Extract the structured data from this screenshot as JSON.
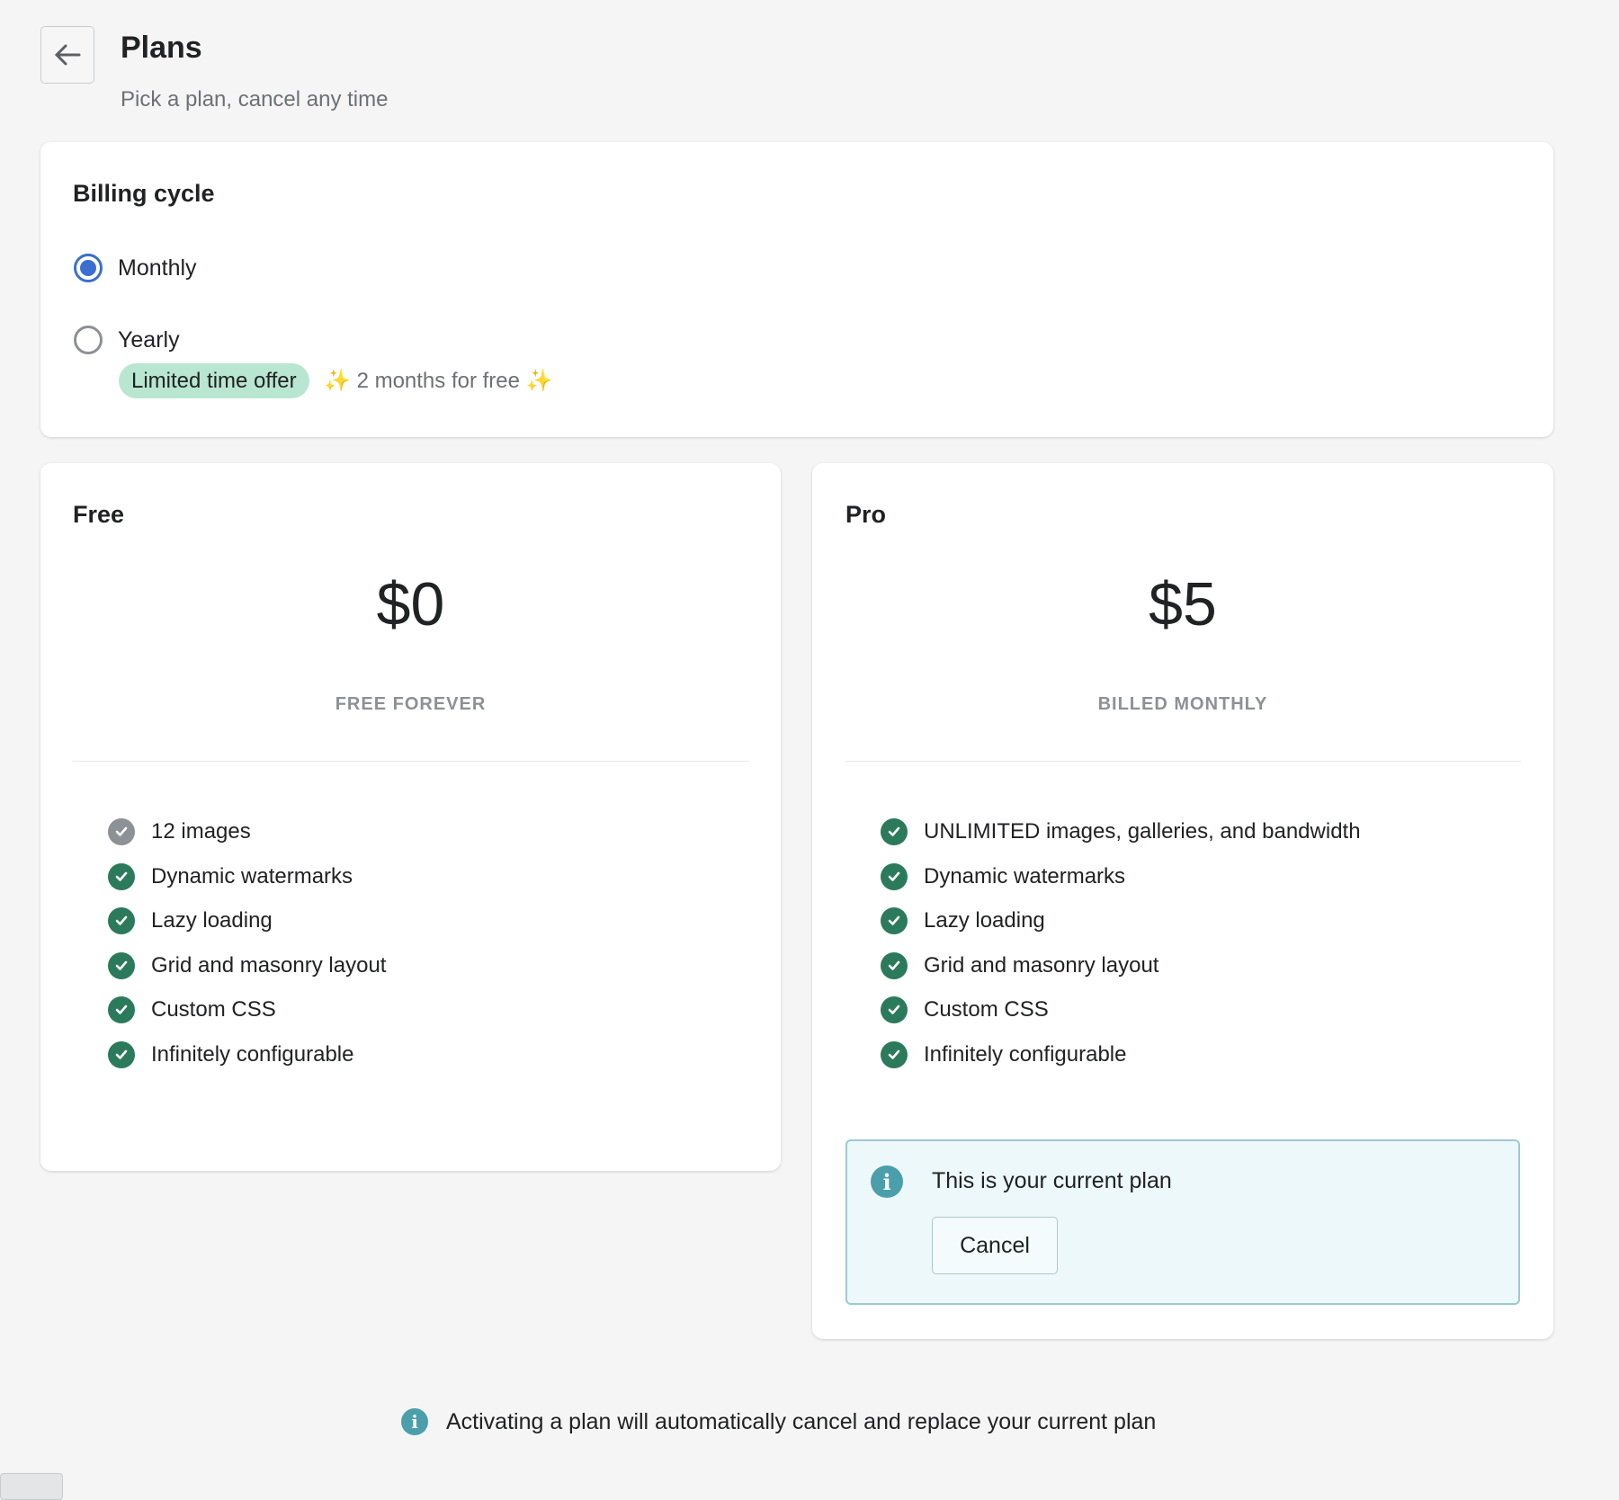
{
  "header": {
    "title": "Plans",
    "subtitle": "Pick a plan, cancel any time",
    "back_icon": "arrow-left-icon"
  },
  "billing": {
    "title": "Billing cycle",
    "options": [
      {
        "label": "Monthly",
        "selected": true
      },
      {
        "label": "Yearly",
        "selected": false
      }
    ],
    "badge": "Limited time offer",
    "offer_text": "2 months for free",
    "sparkle": "✨"
  },
  "plans": [
    {
      "name": "Free",
      "price": "$0",
      "period": "FREE FOREVER",
      "features": [
        {
          "text": "12 images",
          "included": "partial"
        },
        {
          "text": "Dynamic watermarks"
        },
        {
          "text": "Lazy loading"
        },
        {
          "text": "Grid and masonry layout"
        },
        {
          "text": "Custom CSS"
        },
        {
          "text": "Infinitely configurable"
        }
      ]
    },
    {
      "name": "Pro",
      "price": "$5",
      "period": "BILLED MONTHLY",
      "features": [
        {
          "text": "UNLIMITED images, galleries, and bandwidth"
        },
        {
          "text": "Dynamic watermarks"
        },
        {
          "text": "Lazy loading"
        },
        {
          "text": "Grid and masonry layout"
        },
        {
          "text": "Custom CSS"
        },
        {
          "text": "Infinitely configurable"
        }
      ],
      "current_plan_text": "This is your current plan",
      "cancel_label": "Cancel"
    }
  ],
  "footer": {
    "note": "Activating a plan will automatically cancel and replace your current plan"
  },
  "colors": {
    "accent": "#3a6fd0",
    "check": "#2b7a5b",
    "info": "#4a9fab",
    "badge": "#b9e6d1"
  }
}
